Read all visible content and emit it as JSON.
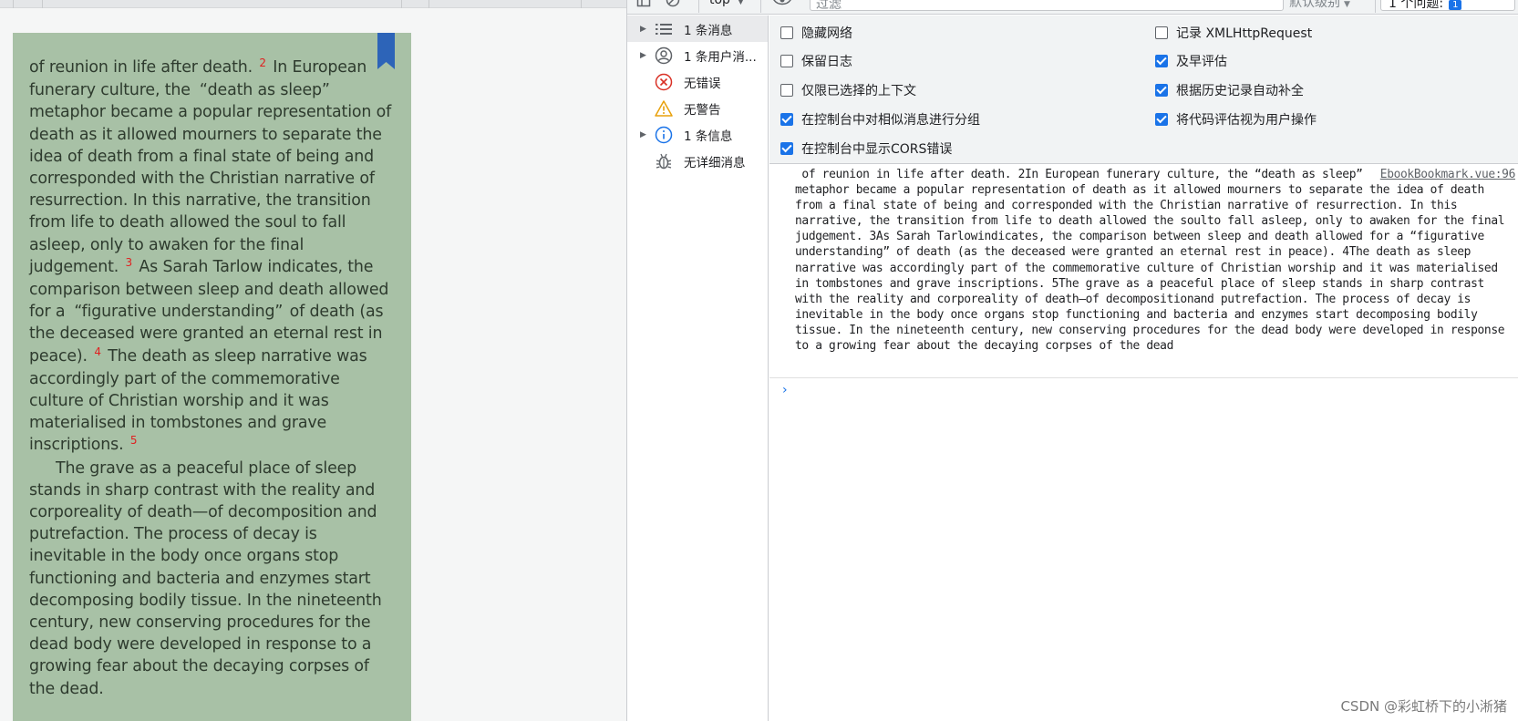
{
  "ebook": {
    "para1": {
      "t1": "of reunion in life after death.",
      "fn1": "2",
      "t2": "In European funerary culture, the",
      "q1": "“death as sleep”",
      "t3": "metaphor became a popular representation of death as it allowed mourners to separate the idea of death from a final state of being and corresponded with the Christian narrative of resurrection. In this narrative, the transition from life to death allowed the soul to fall asleep, only to awaken for the final judgement.",
      "fn2": "3",
      "t4": "As Sarah Tarlow indicates, the comparison between sleep and death allowed for a",
      "q2": "“figurative understanding”",
      "t5": "of death (as the deceased were granted an eternal rest in peace).",
      "fn3": "4",
      "t6": "The death as sleep narrative was accordingly part of the commemorative culture of Christian worship and it was materialised in tombstones and grave inscriptions.",
      "fn4": "5"
    },
    "para2": "The grave as a peaceful place of sleep stands in sharp contrast with the reality and corporeality of death—of decomposition and putrefaction. The process of decay is inevitable in the body once organs stop functioning and bacteria and enzymes start decomposing bodily tissue. In the nineteenth century, new conserving procedures for the dead body were developed in response to a growing fear about the decaying corpses of the dead."
  },
  "devtools": {
    "toolbar": {
      "context": "top",
      "filter_placeholder": "过滤",
      "levels": "默认级别",
      "issues_label": "1 个问题:",
      "issues_count": "1"
    },
    "sidebar": [
      {
        "label": "1 条消息",
        "icon": "list-icon",
        "expandable": true,
        "selected": true
      },
      {
        "label": "1 条用户消...",
        "icon": "user-icon",
        "expandable": true,
        "selected": false
      },
      {
        "label": "无错误",
        "icon": "error-icon",
        "expandable": false,
        "selected": false
      },
      {
        "label": "无警告",
        "icon": "warning-icon",
        "expandable": false,
        "selected": false
      },
      {
        "label": "1 条信息",
        "icon": "info-icon",
        "expandable": true,
        "selected": false
      },
      {
        "label": "无详细消息",
        "icon": "bug-icon",
        "expandable": false,
        "selected": false
      }
    ],
    "settings_left": [
      {
        "label": "隐藏网络",
        "checked": false
      },
      {
        "label": "保留日志",
        "checked": false
      },
      {
        "label": "仅限已选择的上下文",
        "checked": false
      },
      {
        "label": "在控制台中对相似消息进行分组",
        "checked": true
      },
      {
        "label": "在控制台中显示CORS错误",
        "checked": true
      }
    ],
    "settings_right": [
      {
        "label": "记录 XMLHttpRequest",
        "checked": false
      },
      {
        "label": "及早评估",
        "checked": true
      },
      {
        "label": "根据历史记录自动补全",
        "checked": true
      },
      {
        "label": "将代码评估视为用户操作",
        "checked": true
      }
    ],
    "log": {
      "source": "EbookBookmark.vue:96",
      "text": " of reunion in life after death. 2In European funerary culture, the “death as sleep” metaphor became a popular representation of death as it allowed mourners to separate the idea of death from a final state of being and corresponded with the Christian narrative of resurrection. In this narrative, the transition from life to death allowed the soulto fall asleep, only to awaken for the final judgement. 3As Sarah Tarlowindicates, the comparison between sleep and death allowed for a “figurative understanding” of death (as the deceased were granted an eternal rest in peace). 4The death as sleep narrative was accordingly part of the commemorative culture of Christian worship and it was materialised in tombstones and grave inscriptions. 5The grave as a peaceful place of sleep stands in sharp contrast with the reality and corporeality of death—of decompositionand putrefaction. The process of decay is inevitable in the body once organs stop functioning and bacteria and enzymes start decomposing bodily tissue. In the nineteenth century, new conserving procedures for the dead body were developed in response to a growing fear about the decaying corpses of the dead"
    },
    "prompt": "›"
  },
  "watermark": "CSDN @彩虹桥下的小淅猪",
  "colors": {
    "page_bg": "#a8c1a6",
    "bookmark": "#2d64b8",
    "footnote": "#e02020",
    "checkbox_checked": "#1a73e8"
  }
}
